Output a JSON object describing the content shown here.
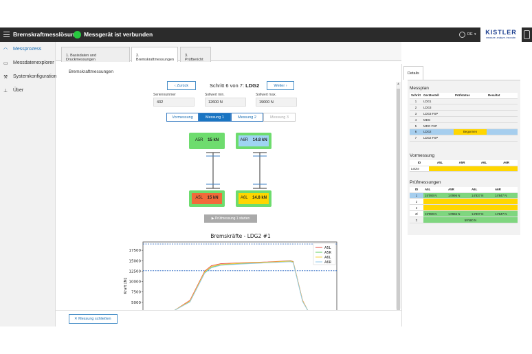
{
  "app": {
    "title": "Bremskraftmesslösung",
    "status": "Messgerät ist verbunden",
    "language": "DE",
    "logo": "KISTLER",
    "logo_tagline": "measure. analyze. innovate."
  },
  "sidebar": {
    "items": [
      {
        "label": "Messprozess",
        "icon": "gauge-icon",
        "active": true
      },
      {
        "label": "Messdatenexplorer",
        "icon": "folder-icon"
      },
      {
        "label": "Systemkonfiguration",
        "icon": "wrench-icon"
      },
      {
        "label": "Über",
        "icon": "info-icon"
      }
    ]
  },
  "tabs": [
    "1. Basisdaten und Druckmessungen",
    "2. Bremskraftmessungen",
    "3. Prüfbericht"
  ],
  "section_title": "Bremskraftmessungen",
  "step": {
    "back": "Zurück",
    "text_prefix": "Schritt 6 von 7:",
    "text_name": "LDG2",
    "next": "Weiter"
  },
  "fields": [
    {
      "label": "Seriennummer",
      "value": "432"
    },
    {
      "label": "Sollwert min.",
      "value": "12600 N"
    },
    {
      "label": "Sollwert max.",
      "value": "19000 N"
    }
  ],
  "measure_tabs": [
    "Vormessung",
    "Messung 1",
    "Messung 2",
    "Messung 3"
  ],
  "sensors": [
    {
      "name": "A5R",
      "value": "15 kN",
      "color": "#6edc6e"
    },
    {
      "name": "A6R",
      "value": "14.8 kN",
      "color": "#9fd4f2"
    },
    {
      "name": "A5L",
      "value": "15 kN",
      "color": "#f26a3a"
    },
    {
      "name": "A6L",
      "value": "14.8 kN",
      "color": "#ffd600"
    }
  ],
  "start_button": "Prüfmessung 1 starten",
  "close_button": "Messung schließen",
  "chart_data": {
    "type": "line",
    "title": "Bremskräfte - LDG2 #1",
    "ylabel": "Kraft [N]",
    "yticks": [
      5000,
      7500,
      10000,
      12500,
      15000,
      17500
    ],
    "ylim": [
      3000,
      19500
    ],
    "xlim": [
      0,
      10
    ],
    "hlines": [
      19000,
      12600
    ],
    "series": [
      {
        "name": "A5L",
        "color": "#e84a3c",
        "x": [
          0,
          1.2,
          2.3,
          2.8,
          3.5,
          5,
          7,
          8.7,
          8.9,
          9.6,
          10
        ],
        "y": [
          3000,
          5500,
          12500,
          13800,
          14300,
          14500,
          14700,
          15000,
          14800,
          5500,
          3000
        ]
      },
      {
        "name": "A5R",
        "color": "#5fcf5f",
        "x": [
          0,
          1.2,
          2.3,
          2.8,
          3.5,
          5,
          7,
          8.7,
          8.9,
          9.6,
          10
        ],
        "y": [
          3000,
          5200,
          12100,
          13400,
          14000,
          14300,
          14600,
          14900,
          14700,
          5300,
          3000
        ]
      },
      {
        "name": "A6L",
        "color": "#f6d13a",
        "x": [
          0,
          1.2,
          2.3,
          2.8,
          3.5,
          5,
          7,
          8.7,
          8.9,
          9.6,
          10
        ],
        "y": [
          3000,
          5300,
          12300,
          13600,
          14100,
          14400,
          14650,
          14850,
          14650,
          5400,
          3000
        ]
      },
      {
        "name": "A6R",
        "color": "#8fc7ea",
        "x": [
          0,
          1.2,
          2.3,
          2.8,
          3.5,
          5,
          7,
          8.7,
          8.9,
          9.6,
          10
        ],
        "y": [
          3000,
          5100,
          12000,
          13300,
          13900,
          14200,
          14500,
          14750,
          14550,
          5200,
          3000
        ]
      }
    ]
  },
  "details": {
    "tab": "Details",
    "messplan": {
      "title": "Messplan",
      "headers": [
        "Schritt",
        "Gerätestell",
        "Prüfstatus",
        "Resultat"
      ],
      "rows": [
        [
          "1",
          "LDG1",
          "",
          ""
        ],
        [
          "2",
          "LDG3",
          "",
          ""
        ],
        [
          "3",
          "LDG3 FSP",
          "",
          ""
        ],
        [
          "4",
          "MDG",
          "",
          ""
        ],
        [
          "5",
          "MDG FSP",
          "",
          ""
        ],
        [
          "6",
          "LDG2",
          "Begonnen",
          ""
        ],
        [
          "7",
          "LDG2 FSP",
          "",
          ""
        ]
      ]
    },
    "vormessung": {
      "title": "Vormessung",
      "headers": [
        "ID",
        "A5L",
        "A5R",
        "A6L",
        "A6R"
      ],
      "row_label": "Letzte"
    },
    "pruefmessungen": {
      "title": "Prüfmessungen",
      "headers": [
        "ID",
        "A5L",
        "A5R",
        "A6L",
        "A6R"
      ],
      "rows": [
        [
          "1",
          "15'090 N",
          "14'996 N",
          "14'837 N",
          "14'847 N"
        ],
        [
          "2",
          "",
          "",
          "",
          ""
        ],
        [
          "3",
          "",
          "",
          "",
          ""
        ],
        [
          "Ø",
          "15'090 N",
          "14'996 N",
          "14'837 N",
          "14'847 N"
        ],
        [
          "Σ",
          "",
          "59'580 N",
          "",
          ""
        ]
      ]
    }
  }
}
